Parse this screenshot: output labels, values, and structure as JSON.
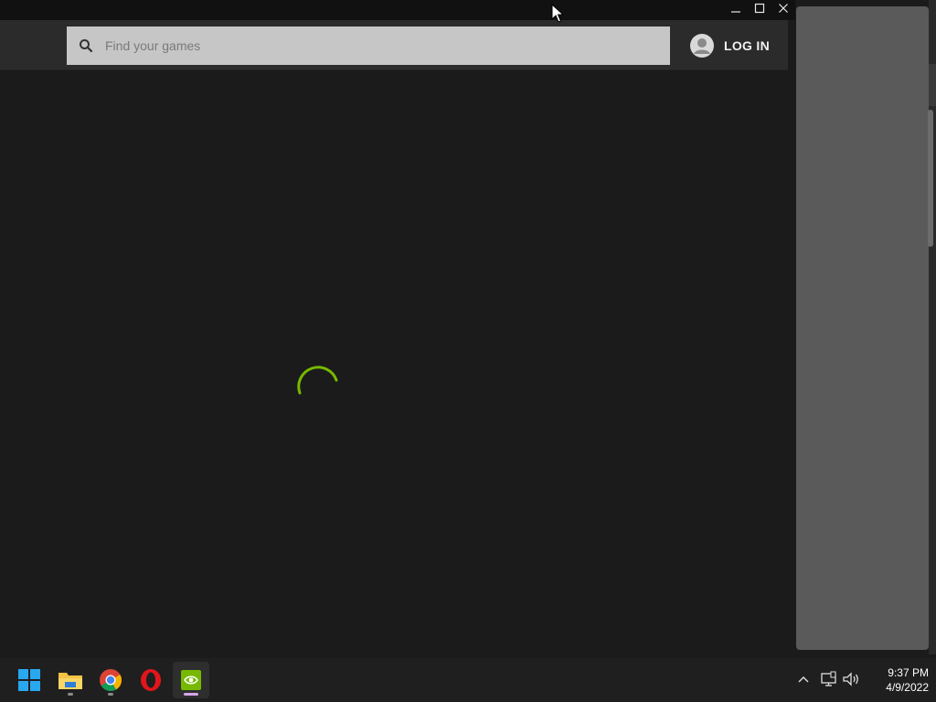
{
  "search": {
    "placeholder": "Find your games"
  },
  "header": {
    "login_label": "LOG IN"
  },
  "clock": {
    "time": "9:37 PM",
    "date": "4/9/2022"
  },
  "taskbar": {
    "apps": [
      "Start",
      "File Explorer",
      "Google Chrome",
      "Opera",
      "NVIDIA GeForce Experience"
    ]
  },
  "colors": {
    "accent": "#76b900",
    "background": "#1b1b1b",
    "header": "#2b2b2b",
    "search_box": "#c6c6c6"
  },
  "icons": [
    "minimize-icon",
    "maximize-icon",
    "close-icon",
    "search-icon",
    "avatar-icon",
    "loading-spinner",
    "windows-start-icon",
    "folder-icon",
    "chrome-icon",
    "opera-icon",
    "nvidia-icon",
    "chevron-up-icon",
    "network-icon",
    "volume-icon"
  ]
}
